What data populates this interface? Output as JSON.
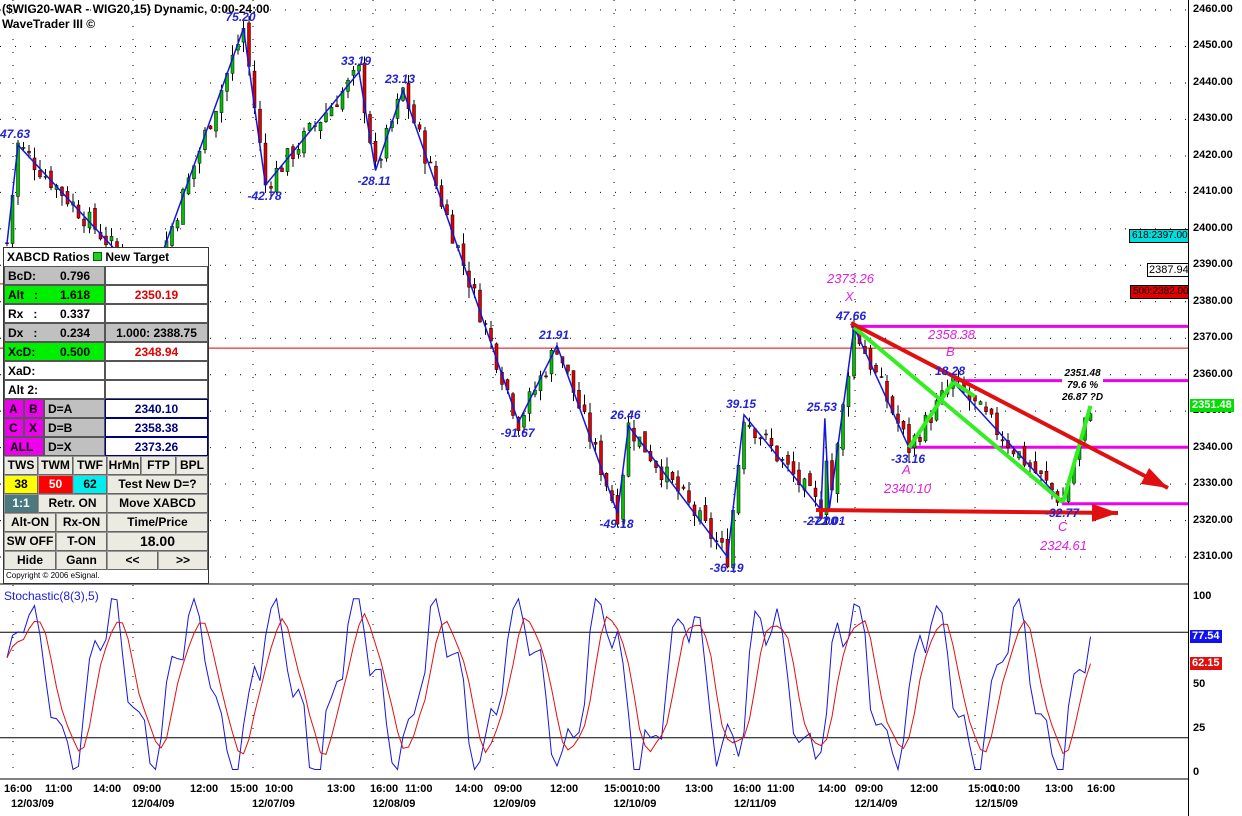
{
  "header": {
    "title": "($WIG20-WAR - WIG20,15) Dynamic, 0:00-24:00",
    "subtitle": "WaveTrader III ©"
  },
  "price_axis": {
    "ticks": [
      "2460.00",
      "2450.00",
      "2440.00",
      "2430.00",
      "2420.00",
      "2410.00",
      "2400.00",
      "2390.00",
      "2380.00",
      "2370.00",
      "2360.00",
      "2350.00",
      "2340.00",
      "2330.00",
      "2320.00",
      "2310.00"
    ],
    "last_price": "2351.48",
    "last_color": "#00e000",
    "marker_2387": "2387.94",
    "flag_618": "618:2397.00",
    "flag_500": "500:2382.00"
  },
  "stoch_axis": {
    "ticks": [
      "100",
      "50",
      "25",
      "0"
    ],
    "blue_value": "77.54",
    "red_value": "62.15",
    "title": "Stochastic(8(3),5)"
  },
  "time_axis": {
    "times": [
      "16:00",
      "11:00",
      "14:00",
      "09:00",
      "12:00",
      "15:00",
      "10:00",
      "13:00",
      "16:00",
      "11:00",
      "14:00",
      "09:00",
      "12:00",
      "15:00",
      "10:00",
      "13:00",
      "16:00",
      "11:00",
      "14:00",
      "09:00",
      "12:00",
      "15:00",
      "10:00",
      "13:00",
      "16:00"
    ],
    "dates": [
      "12/03/09",
      "12/04/09",
      "12/07/09",
      "12/08/09",
      "12/09/09",
      "12/10/09",
      "12/11/09",
      "12/14/09",
      "12/15/09"
    ]
  },
  "panel": {
    "header": "XABCD Ratios",
    "new_target": "New Target",
    "rows": [
      {
        "k": "BcD:",
        "v": "0.796",
        "r": ""
      },
      {
        "k": "Alt   :",
        "v": "1.618",
        "r": "2350.19"
      },
      {
        "k": "Rx   :",
        "v": "0.337",
        "r": ""
      },
      {
        "k": "Dx   :",
        "v": "0.234",
        "r": "1.000: 2388.75"
      },
      {
        "k": "XcD:",
        "v": "0.500",
        "r": "2348.94"
      },
      {
        "k": "XaD:",
        "v": "",
        "r": ""
      },
      {
        "k": "Alt 2:",
        "v": "",
        "r": ""
      }
    ],
    "targets": [
      {
        "a": "A",
        "b": "B",
        "d": "D=A",
        "v": "2340.10"
      },
      {
        "a": "C",
        "b": "X",
        "d": "D=B",
        "v": "2358.38"
      },
      {
        "a": "ALL",
        "b": "",
        "d": "D=X",
        "v": "2373.26"
      }
    ],
    "buttons_row1": [
      "TWS",
      "TWM",
      "TWF",
      "HrMn",
      "FTP",
      "BPL"
    ],
    "fib": [
      "38",
      "50",
      "62"
    ],
    "test_new": "Test New D=?",
    "one_one": "1:1",
    "retr": "Retr. ON",
    "move": "Move XABCD",
    "alt_on": "Alt-ON",
    "rx_on": "Rx-ON",
    "time_price": "Time/Price",
    "sw_off": "SW OFF",
    "t_on": "T-ON",
    "value": "18.00",
    "hide": "Hide",
    "gann": "Gann",
    "prev": "<<",
    "next": ">>",
    "copyright": "Copyright © 2006 eSignal."
  },
  "chart_data": {
    "type": "candlestick",
    "title": "($WIG20-WAR - WIG20,15) Dynamic, 0:00-24:00",
    "ylim": [
      2305,
      2462
    ],
    "wave_pivots": [
      {
        "bar": 0,
        "price": 2396,
        "label": ""
      },
      {
        "bar": 2,
        "price": 2423,
        "label": "47.63"
      },
      {
        "bar": 26,
        "price": 2384,
        "label": ""
      },
      {
        "bar": 43,
        "price": 2455,
        "label": "75.20"
      },
      {
        "bar": 47,
        "price": 2412,
        "label": "-42.78"
      },
      {
        "bar": 64,
        "price": 2443,
        "label": "33.19"
      },
      {
        "bar": 67,
        "price": 2416,
        "label": "-28.11"
      },
      {
        "bar": 72,
        "price": 2438,
        "label": "23.13"
      },
      {
        "bar": 93,
        "price": 2347,
        "label": "-91.67"
      },
      {
        "bar": 100,
        "price": 2368,
        "label": "21.91"
      },
      {
        "bar": 111,
        "price": 2322,
        "label": "-49.18"
      },
      {
        "bar": 113,
        "price": 2346,
        "label": "26.46"
      },
      {
        "bar": 131,
        "price": 2310,
        "label": "-36.19"
      },
      {
        "bar": 134,
        "price": 2349,
        "label": "39.15"
      },
      {
        "bar": 148,
        "price": 2323,
        "label": "-27.00"
      },
      {
        "bar": 148.7,
        "price": 2348,
        "label": "25.53"
      },
      {
        "bar": 149.5,
        "price": 2323,
        "label": "-22.01"
      },
      {
        "bar": 154,
        "price": 2373,
        "label": "47.66"
      },
      {
        "bar": 164,
        "price": 2340,
        "label": "-33.16"
      },
      {
        "bar": 172,
        "price": 2358,
        "label": "18.28"
      },
      {
        "bar": 192,
        "price": 2325,
        "label": "-32.77"
      },
      {
        "bar": 197,
        "price": 2351.48,
        "label": ""
      }
    ],
    "xabcd": {
      "X": {
        "label": "X",
        "price": "2373.26"
      },
      "A": {
        "label": "A",
        "price": "2340.10"
      },
      "B": {
        "label": "B",
        "price": "2358.38"
      },
      "C": {
        "label": "C",
        "price": "2324.61"
      }
    },
    "projection": {
      "price": "2351.48",
      "pct": "79.6 %",
      "d": "26.87 ?D"
    },
    "levels": [
      2373.26,
      2358.38,
      2340.1,
      2324.61
    ],
    "red_lines": [
      2367.3,
      2384.9
    ],
    "stochastic": {
      "overbought": 80,
      "oversold": 20,
      "last_k": 77.54,
      "last_d": 62.15
    }
  }
}
